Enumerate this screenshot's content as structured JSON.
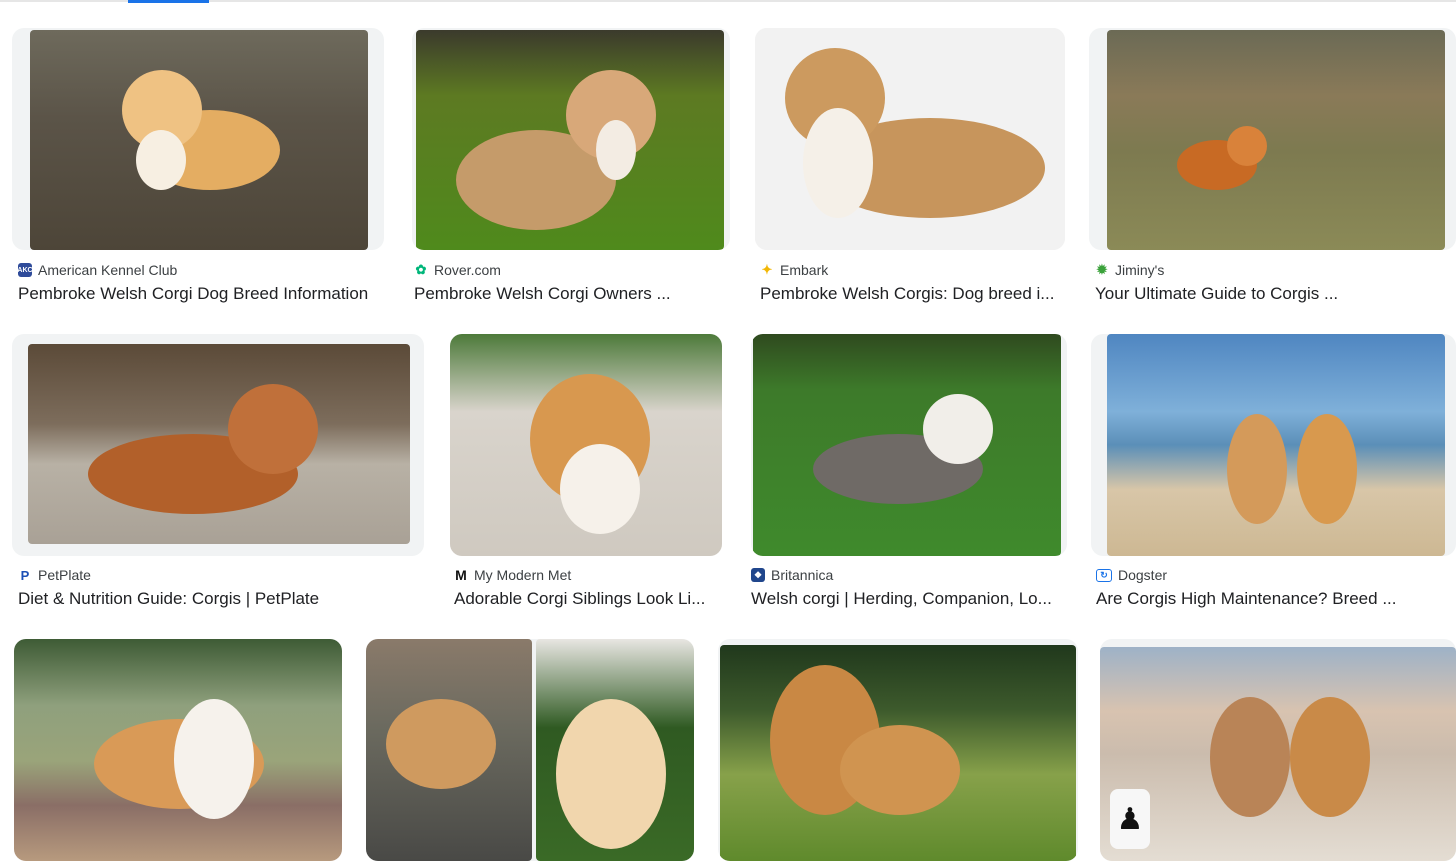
{
  "results": [
    {
      "source": "American Kennel Club",
      "favicon": "akc-icon",
      "title": "Pembroke Welsh Corgi Dog Breed Information"
    },
    {
      "source": "Rover.com",
      "favicon": "paw-icon",
      "title": "Pembroke Welsh Corgi Owners ..."
    },
    {
      "source": "Embark",
      "favicon": "sparkle-icon",
      "title": "Pembroke Welsh Corgis: Dog breed i..."
    },
    {
      "source": "Jiminy's",
      "favicon": "leaf-icon",
      "title": "Your Ultimate Guide to Corgis ..."
    },
    {
      "source": "PetPlate",
      "favicon": "petplate-icon",
      "title": "Diet & Nutrition Guide: Corgis | PetPlate"
    },
    {
      "source": "My Modern Met",
      "favicon": "m-logo-icon",
      "title": "Adorable Corgi Siblings Look Li..."
    },
    {
      "source": "Britannica",
      "favicon": "britannica-icon",
      "title": "Welsh corgi | Herding, Companion, Lo..."
    },
    {
      "source": "Dogster",
      "favicon": "dogster-icon",
      "title": "Are Corgis High Maintenance? Breed ..."
    }
  ]
}
